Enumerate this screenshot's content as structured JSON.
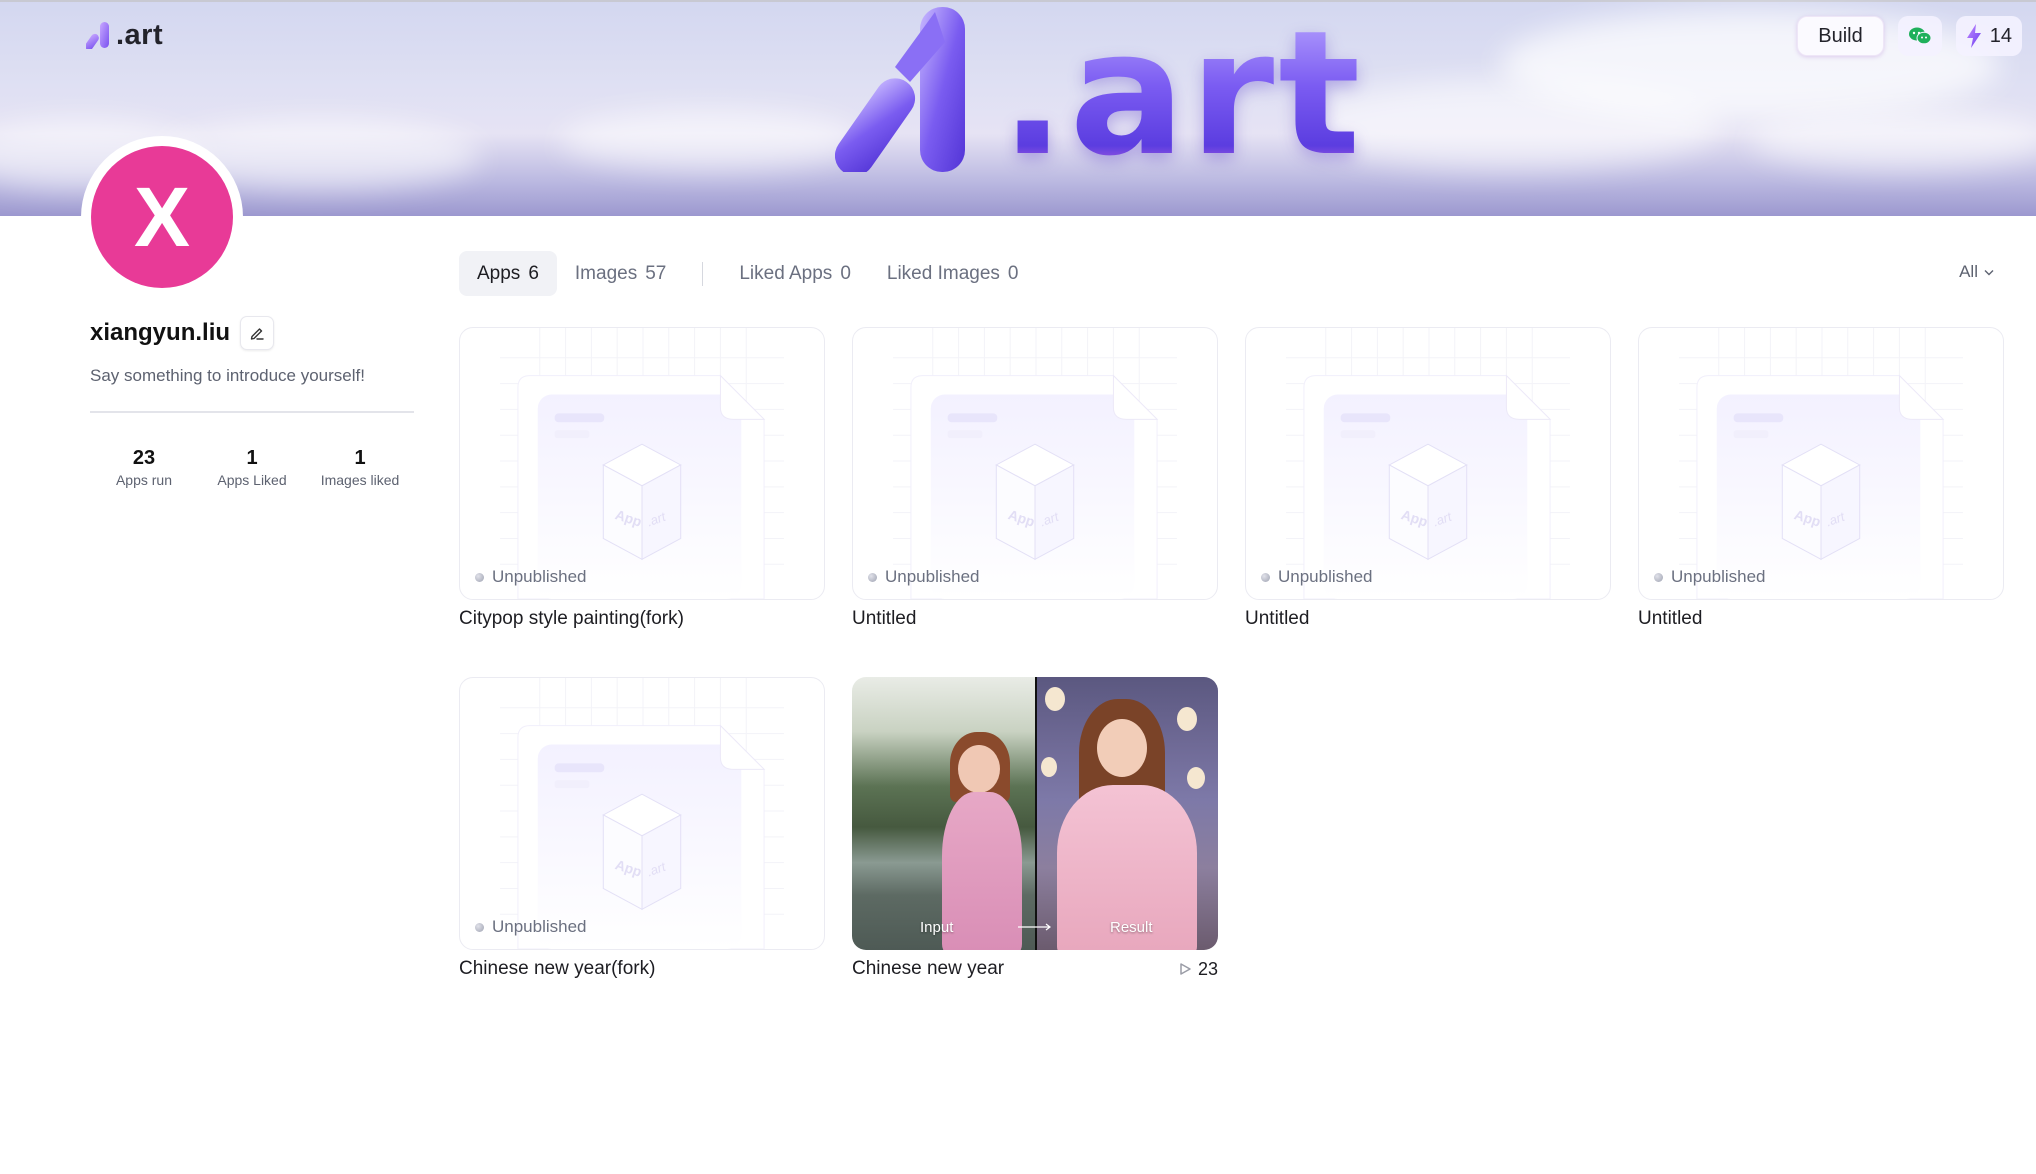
{
  "brand": {
    "name": ".art",
    "hero_text": ".art"
  },
  "nav": {
    "build_label": "Build",
    "wechat_icon": "wechat-icon",
    "credits": {
      "icon": "lightning-icon",
      "value": "14"
    }
  },
  "profile": {
    "avatar_initial": "X",
    "avatar_color": "#e83a97",
    "username": "xiangyun.liu",
    "bio": "Say something to introduce yourself!",
    "stats": [
      {
        "value": "23",
        "label": "Apps run"
      },
      {
        "value": "1",
        "label": "Apps Liked"
      },
      {
        "value": "1",
        "label": "Images liked"
      }
    ]
  },
  "tabs": [
    {
      "label": "Apps",
      "count": "6",
      "active": true
    },
    {
      "label": "Images",
      "count": "57",
      "active": false
    },
    {
      "label": "Liked Apps",
      "count": "0",
      "active": false
    },
    {
      "label": "Liked Images",
      "count": "0",
      "active": false
    }
  ],
  "filter": {
    "selected": "All"
  },
  "apps": [
    {
      "title": "Citypop style painting(fork)",
      "status": "Unpublished",
      "type": "placeholder"
    },
    {
      "title": "Untitled",
      "status": "Unpublished",
      "type": "placeholder"
    },
    {
      "title": "Untitled",
      "status": "Unpublished",
      "type": "placeholder"
    },
    {
      "title": "Untitled",
      "status": "Unpublished",
      "type": "placeholder"
    },
    {
      "title": "Chinese new year(fork)",
      "status": "Unpublished",
      "type": "placeholder"
    },
    {
      "title": "Chinese new year",
      "type": "photo",
      "input_label": "Input",
      "result_label": "Result",
      "runs": "23"
    }
  ],
  "placeholder_art": {
    "cube_left": "App",
    "cube_right": ".art"
  }
}
